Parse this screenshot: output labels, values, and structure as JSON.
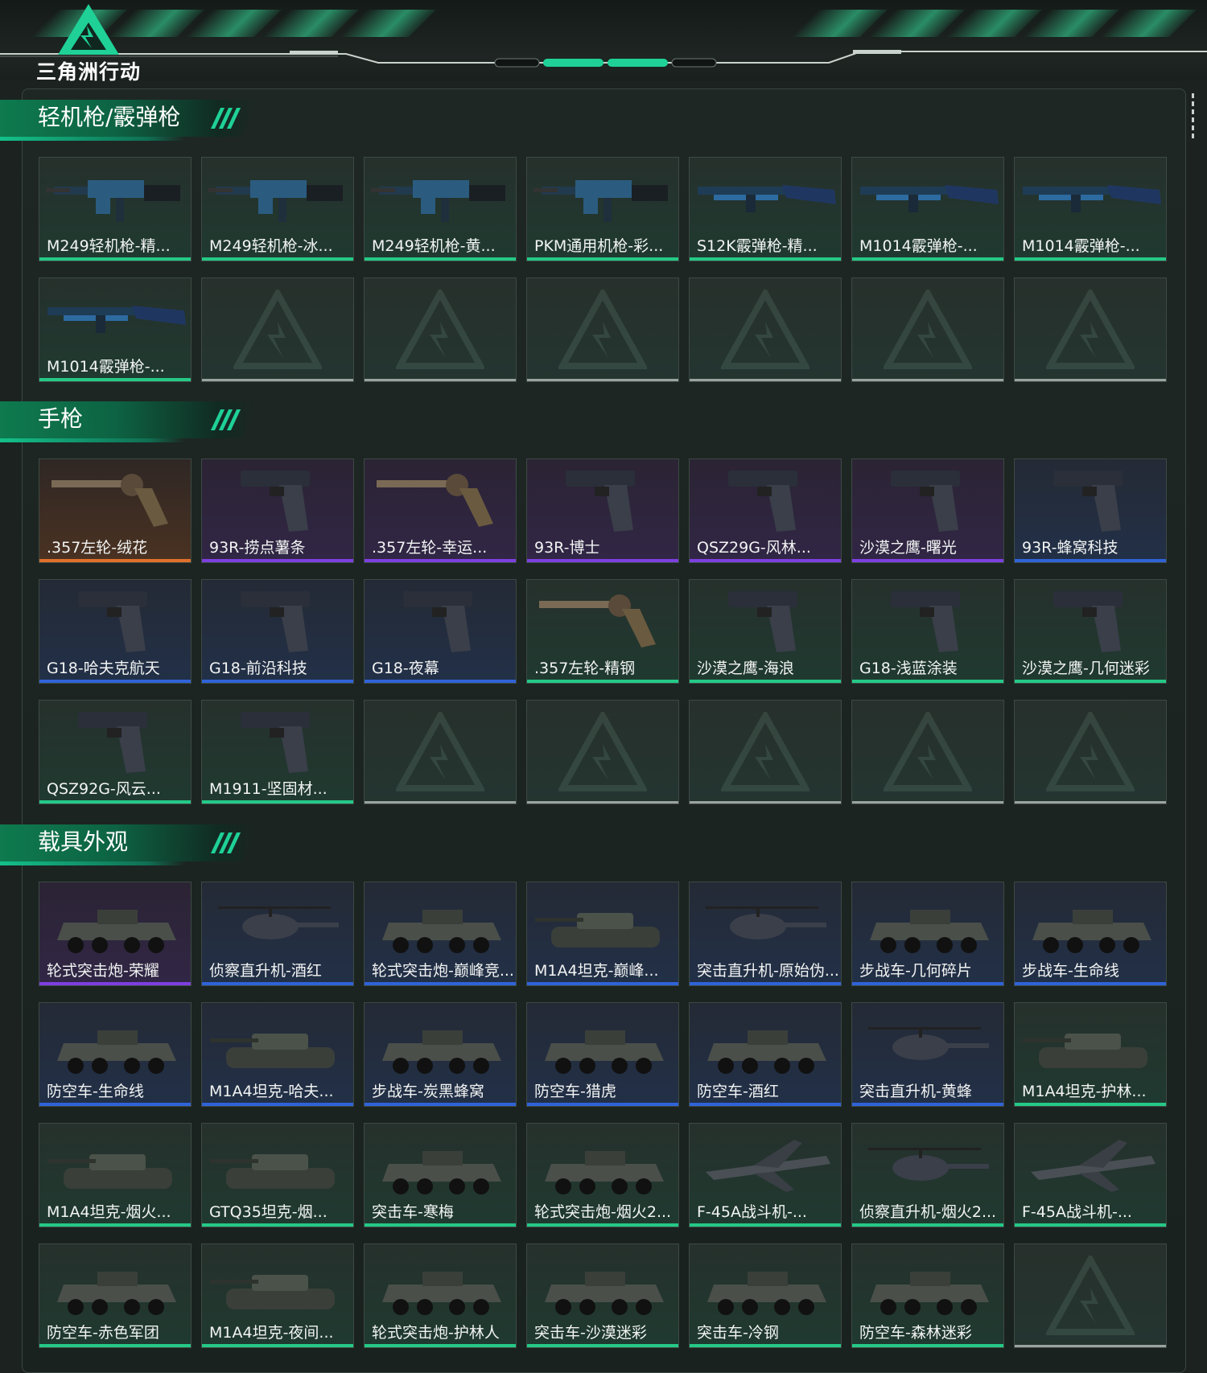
{
  "header": {
    "logo_text": "三角洲行动"
  },
  "sections": [
    {
      "title": "轻机枪/霰弹枪",
      "items": [
        {
          "name": "M249轻机枪-精...",
          "rarity": "green",
          "icon": "machine-gun"
        },
        {
          "name": "M249轻机枪-冰...",
          "rarity": "green",
          "icon": "machine-gun"
        },
        {
          "name": "M249轻机枪-黄...",
          "rarity": "green",
          "icon": "machine-gun"
        },
        {
          "name": "PKM通用机枪-彩...",
          "rarity": "green",
          "icon": "machine-gun"
        },
        {
          "name": "S12K霰弹枪-精...",
          "rarity": "green",
          "icon": "shotgun"
        },
        {
          "name": "M1014霰弹枪-...",
          "rarity": "green",
          "icon": "shotgun"
        },
        {
          "name": "M1014霰弹枪-...",
          "rarity": "green",
          "icon": "shotgun"
        },
        {
          "name": "M1014霰弹枪-...",
          "rarity": "green",
          "icon": "shotgun"
        },
        {
          "name": "",
          "rarity": "empty"
        },
        {
          "name": "",
          "rarity": "empty"
        },
        {
          "name": "",
          "rarity": "empty"
        },
        {
          "name": "",
          "rarity": "empty"
        },
        {
          "name": "",
          "rarity": "empty"
        },
        {
          "name": "",
          "rarity": "empty"
        }
      ]
    },
    {
      "title": "手枪",
      "items": [
        {
          "name": ".357左轮-绒花",
          "rarity": "orange",
          "icon": "revolver"
        },
        {
          "name": "93R-捞点薯条",
          "rarity": "purple",
          "icon": "pistol"
        },
        {
          "name": ".357左轮-幸运...",
          "rarity": "purple",
          "icon": "revolver"
        },
        {
          "name": "93R-博士",
          "rarity": "purple",
          "icon": "pistol"
        },
        {
          "name": "QSZ29G-风林...",
          "rarity": "purple",
          "icon": "pistol"
        },
        {
          "name": "沙漠之鹰-曙光",
          "rarity": "purple",
          "icon": "pistol"
        },
        {
          "name": "93R-蜂窝科技",
          "rarity": "blue",
          "icon": "pistol"
        },
        {
          "name": "G18-哈夫克航天",
          "rarity": "blue",
          "icon": "pistol"
        },
        {
          "name": "G18-前沿科技",
          "rarity": "blue",
          "icon": "pistol"
        },
        {
          "name": "G18-夜幕",
          "rarity": "blue",
          "icon": "pistol"
        },
        {
          "name": ".357左轮-精钢",
          "rarity": "green",
          "icon": "revolver"
        },
        {
          "name": "沙漠之鹰-海浪",
          "rarity": "green",
          "icon": "pistol"
        },
        {
          "name": "G18-浅蓝涂装",
          "rarity": "green",
          "icon": "pistol"
        },
        {
          "name": "沙漠之鹰-几何迷彩",
          "rarity": "green",
          "icon": "pistol"
        },
        {
          "name": "QSZ92G-风云...",
          "rarity": "green",
          "icon": "pistol"
        },
        {
          "name": "M1911-坚固材...",
          "rarity": "green",
          "icon": "pistol"
        },
        {
          "name": "",
          "rarity": "empty"
        },
        {
          "name": "",
          "rarity": "empty"
        },
        {
          "name": "",
          "rarity": "empty"
        },
        {
          "name": "",
          "rarity": "empty"
        },
        {
          "name": "",
          "rarity": "empty"
        }
      ]
    },
    {
      "title": "载具外观",
      "items": [
        {
          "name": "轮式突击炮-荣耀",
          "rarity": "purple",
          "icon": "wheeled-vehicle"
        },
        {
          "name": "侦察直升机-酒红",
          "rarity": "blue",
          "icon": "helicopter"
        },
        {
          "name": "轮式突击炮-巅峰竞...",
          "rarity": "blue",
          "icon": "wheeled-vehicle"
        },
        {
          "name": "M1A4坦克-巅峰...",
          "rarity": "blue",
          "icon": "tank"
        },
        {
          "name": "突击直升机-原始伪...",
          "rarity": "blue",
          "icon": "helicopter"
        },
        {
          "name": "步战车-几何碎片",
          "rarity": "blue",
          "icon": "wheeled-vehicle"
        },
        {
          "name": "步战车-生命线",
          "rarity": "blue",
          "icon": "wheeled-vehicle"
        },
        {
          "name": "防空车-生命线",
          "rarity": "blue",
          "icon": "wheeled-vehicle"
        },
        {
          "name": "M1A4坦克-哈夫...",
          "rarity": "blue",
          "icon": "tank"
        },
        {
          "name": "步战车-炭黑蜂窝",
          "rarity": "blue",
          "icon": "wheeled-vehicle"
        },
        {
          "name": "防空车-猎虎",
          "rarity": "blue",
          "icon": "wheeled-vehicle"
        },
        {
          "name": "防空车-酒红",
          "rarity": "blue",
          "icon": "wheeled-vehicle"
        },
        {
          "name": "突击直升机-黄蜂",
          "rarity": "blue",
          "icon": "helicopter"
        },
        {
          "name": "M1A4坦克-护林...",
          "rarity": "green",
          "icon": "tank"
        },
        {
          "name": "M1A4坦克-烟火...",
          "rarity": "green",
          "icon": "tank"
        },
        {
          "name": "GTQ35坦克-烟...",
          "rarity": "green",
          "icon": "tank"
        },
        {
          "name": "突击车-寒梅",
          "rarity": "green",
          "icon": "wheeled-vehicle"
        },
        {
          "name": "轮式突击炮-烟火2...",
          "rarity": "green",
          "icon": "wheeled-vehicle"
        },
        {
          "name": "F-45A战斗机-...",
          "rarity": "green",
          "icon": "jet"
        },
        {
          "name": "侦察直升机-烟火2...",
          "rarity": "green",
          "icon": "helicopter"
        },
        {
          "name": "F-45A战斗机-...",
          "rarity": "green",
          "icon": "jet"
        },
        {
          "name": "防空车-赤色军团",
          "rarity": "green",
          "icon": "wheeled-vehicle"
        },
        {
          "name": "M1A4坦克-夜间...",
          "rarity": "green",
          "icon": "tank"
        },
        {
          "name": "轮式突击炮-护林人",
          "rarity": "green",
          "icon": "wheeled-vehicle"
        },
        {
          "name": "突击车-沙漠迷彩",
          "rarity": "green",
          "icon": "wheeled-vehicle"
        },
        {
          "name": "突击车-冷钢",
          "rarity": "green",
          "icon": "wheeled-vehicle"
        },
        {
          "name": "防空车-森林迷彩",
          "rarity": "green",
          "icon": "wheeled-vehicle"
        },
        {
          "name": "",
          "rarity": "empty"
        }
      ]
    }
  ],
  "colors": {
    "accent": "#25c987",
    "green": "#25c987",
    "blue": "#2f63d8",
    "purple": "#7e3fe0",
    "orange": "#e0702a",
    "background": "#1b221f"
  }
}
